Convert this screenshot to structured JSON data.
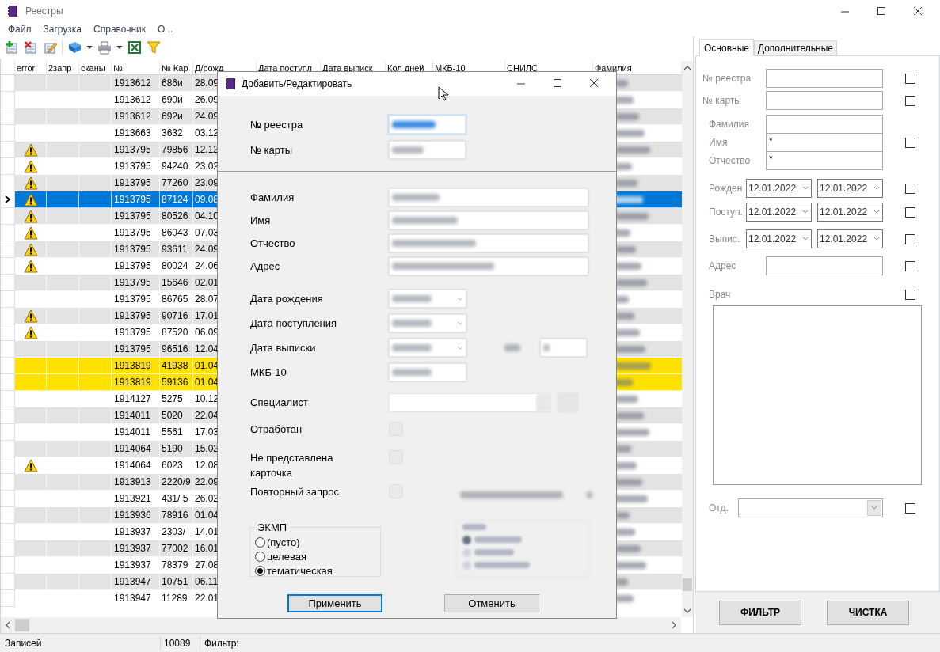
{
  "window": {
    "title": "Реестры"
  },
  "menu": [
    "Файл",
    "Загрузка",
    "Справочник",
    "О .."
  ],
  "table": {
    "columns": [
      "error",
      "2запр",
      "сканы",
      "№",
      "№ Кар",
      "Д/рожд",
      "Дата поступл",
      "Дата выписк",
      "Кол дней",
      "МКБ-10",
      "СНИЛС",
      "Фамилия"
    ],
    "rows": [
      {
        "number": "1913612",
        "card": "686и",
        "birth_date": "28.09",
        "warning": false,
        "selected": false,
        "marked": false
      },
      {
        "number": "1913612",
        "card": "690и",
        "birth_date": "26.09",
        "warning": false,
        "selected": false,
        "marked": false
      },
      {
        "number": "1913612",
        "card": "692и",
        "birth_date": "24.09",
        "warning": false,
        "selected": false,
        "marked": false
      },
      {
        "number": "1913663",
        "card": "3632",
        "birth_date": "03.12",
        "warning": false,
        "selected": false,
        "marked": false
      },
      {
        "number": "1913795",
        "card": "79856",
        "birth_date": "12.12",
        "warning": true,
        "selected": false,
        "marked": false
      },
      {
        "number": "1913795",
        "card": "94240",
        "birth_date": "23.02",
        "warning": true,
        "selected": false,
        "marked": false
      },
      {
        "number": "1913795",
        "card": "77260",
        "birth_date": "23.09",
        "warning": true,
        "selected": false,
        "marked": false
      },
      {
        "number": "1913795",
        "card": "87124",
        "birth_date": "09.08",
        "warning": true,
        "selected": true,
        "marked": false
      },
      {
        "number": "1913795",
        "card": "80526",
        "birth_date": "04.10",
        "warning": true,
        "selected": false,
        "marked": false
      },
      {
        "number": "1913795",
        "card": "86043",
        "birth_date": "07.03",
        "warning": true,
        "selected": false,
        "marked": false
      },
      {
        "number": "1913795",
        "card": "93611",
        "birth_date": "24.09",
        "warning": true,
        "selected": false,
        "marked": false
      },
      {
        "number": "1913795",
        "card": "80024",
        "birth_date": "24.06",
        "warning": true,
        "selected": false,
        "marked": false
      },
      {
        "number": "1913795",
        "card": "15646",
        "birth_date": "02.01",
        "warning": false,
        "selected": false,
        "marked": false
      },
      {
        "number": "1913795",
        "card": "86765",
        "birth_date": "28.07",
        "warning": false,
        "selected": false,
        "marked": false
      },
      {
        "number": "1913795",
        "card": "90716",
        "birth_date": "17.01",
        "warning": true,
        "selected": false,
        "marked": false
      },
      {
        "number": "1913795",
        "card": "87520",
        "birth_date": "06.09",
        "warning": true,
        "selected": false,
        "marked": false
      },
      {
        "number": "1913795",
        "card": "96516",
        "birth_date": "12.04",
        "warning": false,
        "selected": false,
        "marked": false
      },
      {
        "number": "1913819",
        "card": "41938",
        "birth_date": "01.04",
        "warning": false,
        "selected": false,
        "marked": true
      },
      {
        "number": "1913819",
        "card": "59136",
        "birth_date": "01.04",
        "warning": false,
        "selected": false,
        "marked": true
      },
      {
        "number": "1914127",
        "card": "5275",
        "birth_date": "10.12",
        "warning": false,
        "selected": false,
        "marked": false
      },
      {
        "number": "1914011",
        "card": "5020",
        "birth_date": "22.04",
        "warning": false,
        "selected": false,
        "marked": false
      },
      {
        "number": "1914011",
        "card": "5561",
        "birth_date": "17.03",
        "warning": false,
        "selected": false,
        "marked": false
      },
      {
        "number": "1914064",
        "card": "5190",
        "birth_date": "15.02",
        "warning": false,
        "selected": false,
        "marked": false
      },
      {
        "number": "1914064",
        "card": "6023",
        "birth_date": "12.08",
        "warning": true,
        "selected": false,
        "marked": false
      },
      {
        "number": "1913913",
        "card": "2220/9",
        "birth_date": "22.09",
        "warning": false,
        "selected": false,
        "marked": false
      },
      {
        "number": "1913921",
        "card": "431/ 5",
        "birth_date": "26.02",
        "warning": false,
        "selected": false,
        "marked": false
      },
      {
        "number": "1913936",
        "card": "78916",
        "birth_date": "01.04",
        "warning": false,
        "selected": false,
        "marked": false
      },
      {
        "number": "1913937",
        "card": "2303/",
        "birth_date": "14.01",
        "warning": false,
        "selected": false,
        "marked": false
      },
      {
        "number": "1913937",
        "card": "77002",
        "birth_date": "16.01",
        "warning": false,
        "selected": false,
        "marked": false
      },
      {
        "number": "1913937",
        "card": "78379",
        "birth_date": "27.08",
        "warning": false,
        "selected": false,
        "marked": false
      },
      {
        "number": "1913947",
        "card": "10751",
        "birth_date": "06.11",
        "warning": false,
        "selected": false,
        "marked": false
      },
      {
        "number": "1913947",
        "card": "11289",
        "birth_date": "22.01",
        "warning": false,
        "selected": false,
        "marked": false
      }
    ]
  },
  "status_bar": {
    "label": "Записей",
    "count": "10089",
    "filter_label": "Фильтр:"
  },
  "filter_panel": {
    "tabs": [
      {
        "label": "Основные",
        "selected": true
      },
      {
        "label": "Дополнительные",
        "selected": false
      }
    ],
    "fields": [
      {
        "kind": "text",
        "label": "№ реестра",
        "checked": false
      },
      {
        "kind": "text",
        "label": "№ карты",
        "checked": false
      },
      {
        "kind": "name",
        "items": [
          {
            "label": "Фамилия"
          },
          {
            "label": "Имя",
            "value": "*"
          },
          {
            "label": "Отчество",
            "value": "*"
          }
        ],
        "checked": false
      },
      {
        "kind": "date_range",
        "label": "Рожден",
        "from": "12.01.2022",
        "to": "12.01.2022",
        "checked": false
      },
      {
        "kind": "date_range",
        "label": "Поступ.",
        "from": "12.01.2022",
        "to": "12.01.2022",
        "checked": false
      },
      {
        "kind": "date_range",
        "label": "Выпис.",
        "from": "12.01.2022",
        "to": "12.01.2022",
        "checked": false
      },
      {
        "kind": "text",
        "label": "Адрес",
        "checked": false
      },
      {
        "kind": "list",
        "label": "Врач",
        "checked": false
      },
      {
        "kind": "combo",
        "label": "Отд.",
        "checked": false
      }
    ],
    "buttons": [
      "ФИЛЬТР",
      "ЧИСТКА"
    ]
  },
  "dialog": {
    "title": "Добавить/Редактировать",
    "header_fields": [
      {
        "label": "№ реестра",
        "focused": true
      },
      {
        "label": "№ карты",
        "focused": false
      }
    ],
    "fields": [
      {
        "kind": "wide",
        "label": "Фамилия"
      },
      {
        "kind": "wide",
        "label": "Имя"
      },
      {
        "kind": "wide",
        "label": "Отчество"
      },
      {
        "kind": "wide",
        "label": "Адрес"
      },
      {
        "kind": "date",
        "label": "Дата рождения"
      },
      {
        "kind": "date",
        "label": "Дата поступления"
      },
      {
        "kind": "date_days",
        "label": "Дата выписки"
      },
      {
        "kind": "short",
        "label": "МКБ-10"
      },
      {
        "kind": "combo",
        "label": "Специалист"
      },
      {
        "kind": "checkbox",
        "label": "Отработан",
        "checked": false
      },
      {
        "kind": "checkbox",
        "label": "Не представлена карточка",
        "checked": false
      },
      {
        "kind": "checkbox_extra",
        "label": "Повторный запрос",
        "checked": false
      }
    ],
    "radio_group": {
      "title": "ЭКМП",
      "options": [
        {
          "label": "(пусто)",
          "selected": false
        },
        {
          "label": "целевая",
          "selected": false
        },
        {
          "label": "тематическая",
          "selected": true
        }
      ]
    },
    "buttons": [
      {
        "label": "Применить",
        "default": true
      },
      {
        "label": "Отменить",
        "default": false
      }
    ]
  }
}
